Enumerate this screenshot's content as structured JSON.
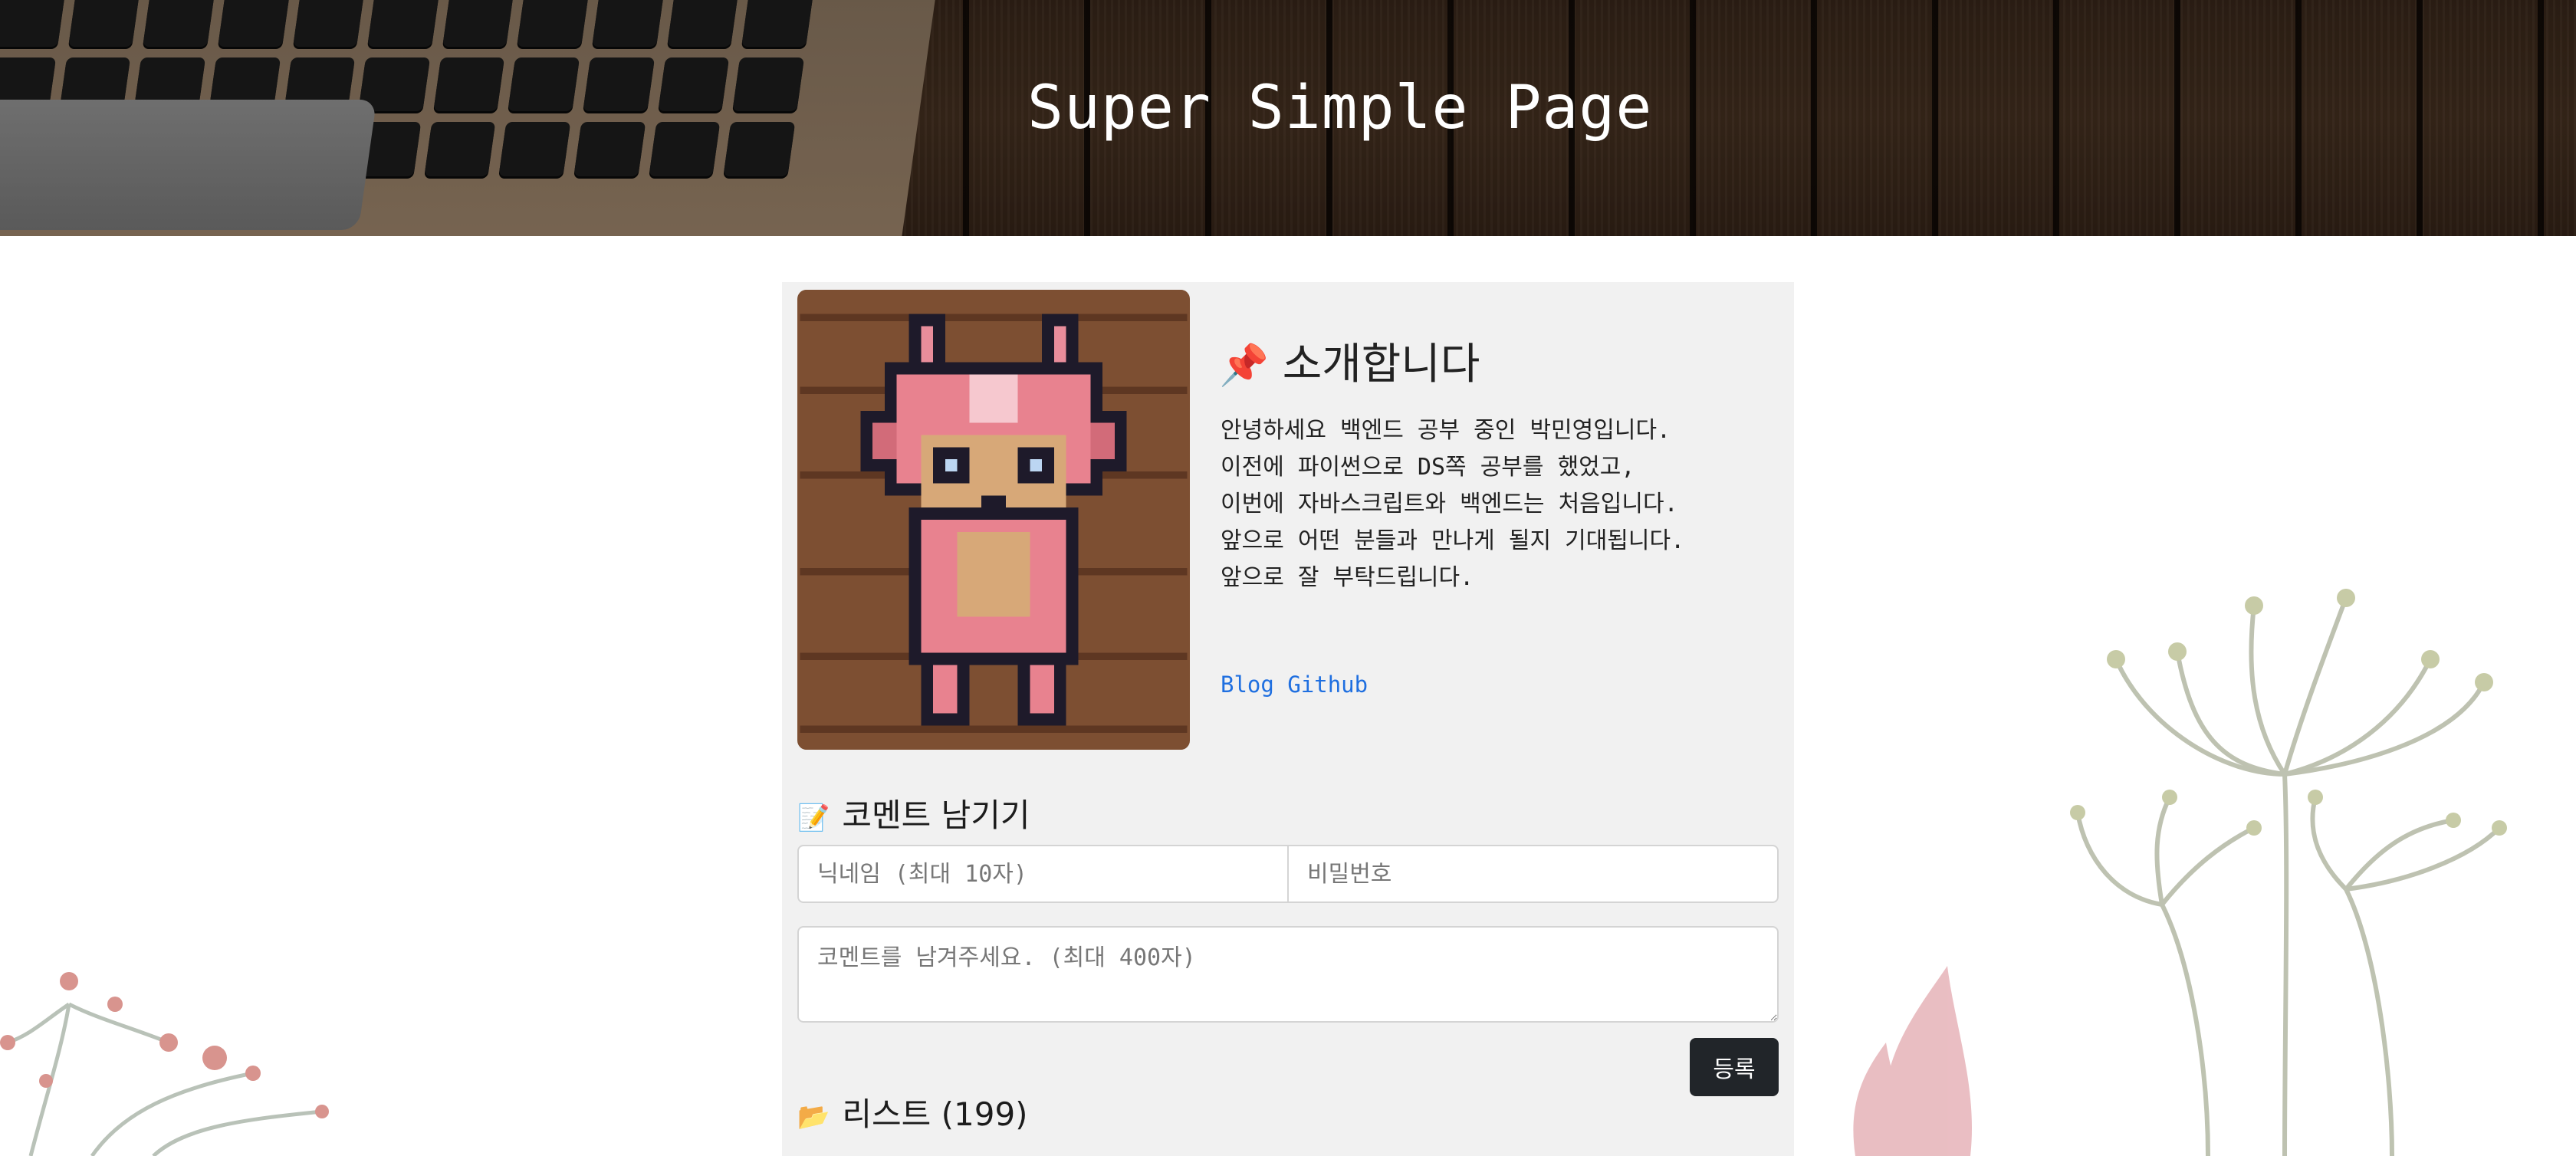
{
  "header": {
    "title": "Super Simple Page"
  },
  "profile": {
    "avatar_alt": "pixel art pink fox character",
    "intro": {
      "icon": "pushpin-icon",
      "title": "소개합니다",
      "lines": [
        "안녕하세요 백엔드 공부 중인 박민영입니다.",
        "이전에 파이썬으로 DS쪽 공부를 했었고,",
        "이번에 자바스크립트와 백엔드는 처음입니다.",
        "앞으로 어떤 분들과 만나게 될지 기대됩니다.",
        "앞으로 잘 부탁드립니다."
      ]
    },
    "links": {
      "blog": "Blog",
      "github": "Github"
    }
  },
  "comment": {
    "icon": "memo-icon",
    "title": "코멘트 남기기",
    "nickname_placeholder": "닉네임 (최대 10자)",
    "password_placeholder": "비밀번호",
    "body_placeholder": "코멘트를 남겨주세요. (최대 400자)",
    "submit_label": "등록"
  },
  "list": {
    "icon": "folder-icon",
    "title": "리스트 (199)"
  },
  "colors": {
    "link": "#1f6fe0",
    "button": "#212529",
    "card_bg": "#f1f1f1"
  }
}
